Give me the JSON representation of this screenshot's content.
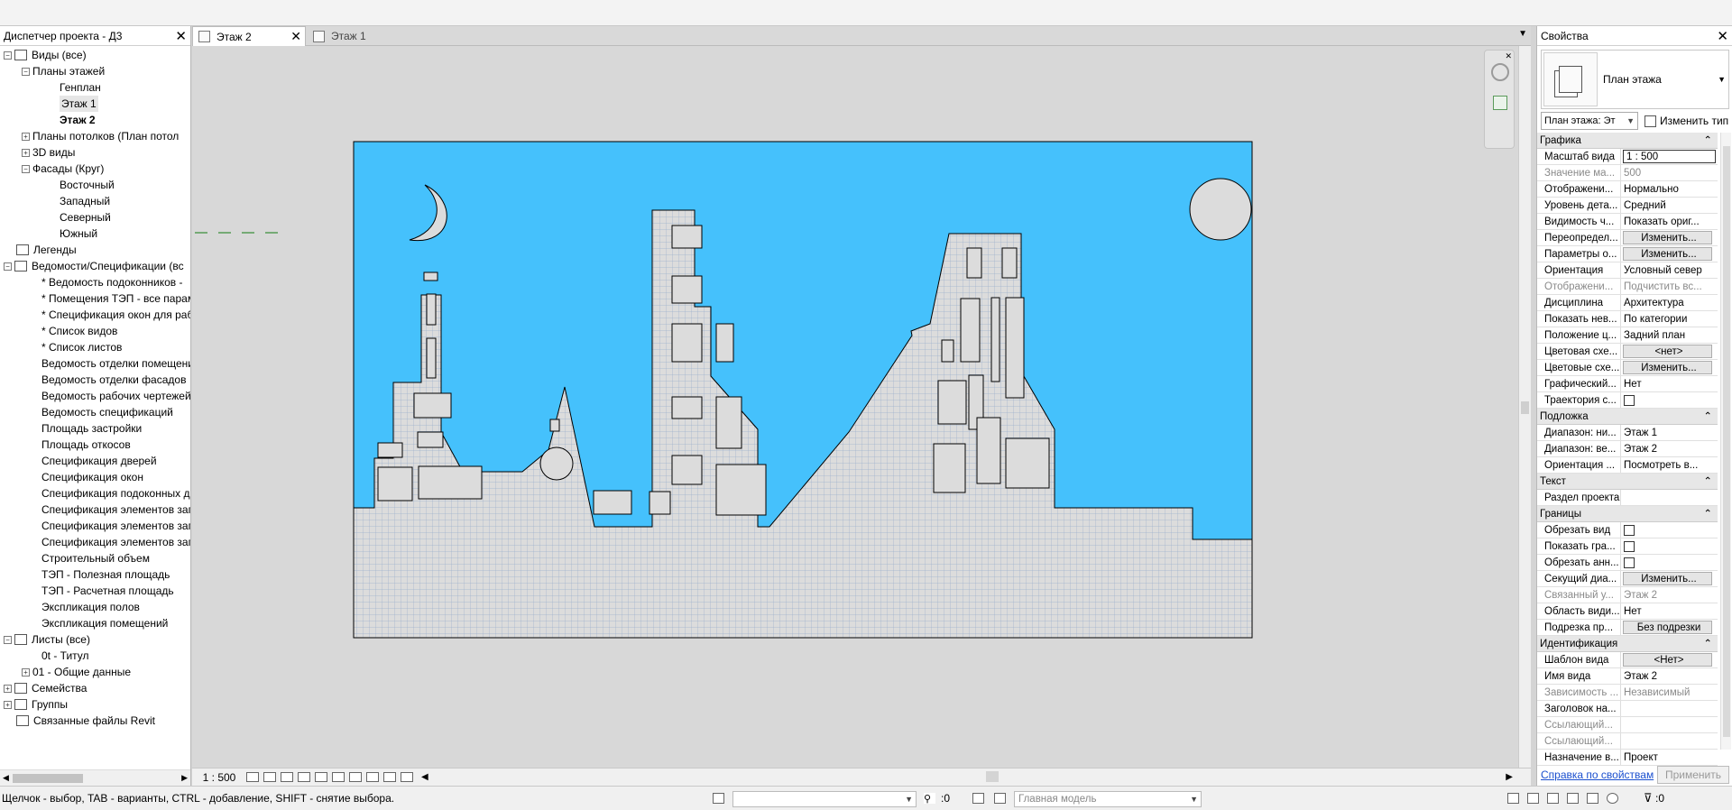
{
  "project_browser": {
    "title": "Диспетчер проекта - Д3",
    "items": [
      {
        "label": "Виды (все)",
        "level": 0,
        "toggle": "−"
      },
      {
        "label": "Планы этажей",
        "level": 1,
        "toggle": "−"
      },
      {
        "label": "Генплан",
        "level": 2
      },
      {
        "label": "Этаж 1",
        "level": 2
      },
      {
        "label": "Этаж 2",
        "level": 2,
        "bold": true
      },
      {
        "label": "Планы потолков (План потол",
        "level": 1,
        "toggle": "+"
      },
      {
        "label": "3D виды",
        "level": 1,
        "toggle": "+"
      },
      {
        "label": "Фасады (Круг)",
        "level": 1,
        "toggle": "−"
      },
      {
        "label": "Восточный",
        "level": 2
      },
      {
        "label": "Западный",
        "level": 2
      },
      {
        "label": "Северный",
        "level": 2
      },
      {
        "label": "Южный",
        "level": 2
      },
      {
        "label": "Легенды",
        "level": 0,
        "icon": true
      },
      {
        "label": "Ведомости/Спецификации (вс",
        "level": 0,
        "toggle": "−",
        "icon": true
      },
      {
        "label": "* Ведомость подоконников -",
        "level": 1
      },
      {
        "label": "* Помещения ТЭП - все парам",
        "level": 1
      },
      {
        "label": "* Спецификация окон для раб",
        "level": 1
      },
      {
        "label": "* Список видов",
        "level": 1
      },
      {
        "label": "* Список листов",
        "level": 1
      },
      {
        "label": "Ведомость отделки помещени",
        "level": 1
      },
      {
        "label": "Ведомость отделки фасадов",
        "level": 1
      },
      {
        "label": "Ведомость рабочих чертежей",
        "level": 1
      },
      {
        "label": "Ведомость спецификаций",
        "level": 1
      },
      {
        "label": "Площадь застройки",
        "level": 1
      },
      {
        "label": "Площадь откосов",
        "level": 1
      },
      {
        "label": "Спецификация дверей",
        "level": 1
      },
      {
        "label": "Спецификация окон",
        "level": 1
      },
      {
        "label": "Спецификация подоконных д",
        "level": 1
      },
      {
        "label": "Спецификация элементов зап",
        "level": 1
      },
      {
        "label": "Спецификация элементов зап",
        "level": 1
      },
      {
        "label": "Спецификация элементов зап",
        "level": 1
      },
      {
        "label": "Строительный объем",
        "level": 1
      },
      {
        "label": "ТЭП - Полезная площадь",
        "level": 1
      },
      {
        "label": "ТЭП - Расчетная площадь",
        "level": 1
      },
      {
        "label": "Экспликация полов",
        "level": 1
      },
      {
        "label": "Экспликация помещений",
        "level": 1
      },
      {
        "label": "Листы (все)",
        "level": 0,
        "toggle": "−",
        "icon": true
      },
      {
        "label": "0t - Титул",
        "level": 1
      },
      {
        "label": "01 - Общие данные",
        "level": 1,
        "toggle": "+"
      },
      {
        "label": "Семейства",
        "level": 0,
        "toggle": "+",
        "icon": true
      },
      {
        "label": "Группы",
        "level": 0,
        "toggle": "+",
        "icon": true
      },
      {
        "label": "Связанные файлы Revit",
        "level": 0,
        "icon": true
      }
    ]
  },
  "tabs": [
    {
      "label": "Этаж 2",
      "active": true
    },
    {
      "label": "Этаж 1",
      "active": false
    }
  ],
  "view_control": {
    "scale": "1 : 500"
  },
  "properties": {
    "title": "Свойства",
    "type_name": "План этажа",
    "filter": "План этажа: Эт",
    "edit_type": "Изменить тип",
    "groups": [
      {
        "name": "Графика",
        "rows": [
          {
            "name": "Масштаб вида",
            "value": "1 : 500",
            "kind": "edit"
          },
          {
            "name": "Значение ма...",
            "value": "500",
            "kind": "gray"
          },
          {
            "name": "Отображени...",
            "value": "Нормально"
          },
          {
            "name": "Уровень дета...",
            "value": "Средний"
          },
          {
            "name": "Видимость ч...",
            "value": "Показать ориг..."
          },
          {
            "name": "Переопредел...",
            "value": "Изменить...",
            "kind": "btn"
          },
          {
            "name": "Параметры о...",
            "value": "Изменить...",
            "kind": "btn"
          },
          {
            "name": "Ориентация",
            "value": "Условный север"
          },
          {
            "name": "Отображени...",
            "value": "Подчистить вс...",
            "kind": "gray"
          },
          {
            "name": "Дисциплина",
            "value": "Архитектура"
          },
          {
            "name": "Показать нев...",
            "value": "По категории"
          },
          {
            "name": "Положение ц...",
            "value": "Задний план"
          },
          {
            "name": "Цветовая схе...",
            "value": "<нет>",
            "kind": "btn"
          },
          {
            "name": "Цветовые схе...",
            "value": "Изменить...",
            "kind": "btn"
          },
          {
            "name": "Графический...",
            "value": "Нет"
          },
          {
            "name": "Траектория с...",
            "value": "",
            "kind": "check"
          }
        ]
      },
      {
        "name": "Подложка",
        "rows": [
          {
            "name": "Диапазон: ни...",
            "value": "Этаж 1"
          },
          {
            "name": "Диапазон: ве...",
            "value": "Этаж 2"
          },
          {
            "name": "Ориентация ...",
            "value": "Посмотреть в..."
          }
        ]
      },
      {
        "name": "Текст",
        "rows": [
          {
            "name": "Раздел проекта",
            "value": ""
          }
        ]
      },
      {
        "name": "Границы",
        "rows": [
          {
            "name": "Обрезать вид",
            "value": "",
            "kind": "check"
          },
          {
            "name": "Показать гра...",
            "value": "",
            "kind": "check"
          },
          {
            "name": "Обрезать анн...",
            "value": "",
            "kind": "check"
          },
          {
            "name": "Секущий диа...",
            "value": "Изменить...",
            "kind": "btn"
          },
          {
            "name": "Связанный у...",
            "value": "Этаж 2",
            "kind": "gray"
          },
          {
            "name": "Область види...",
            "value": "Нет"
          },
          {
            "name": "Подрезка пр...",
            "value": "Без подрезки",
            "kind": "btn"
          }
        ]
      },
      {
        "name": "Идентификация",
        "rows": [
          {
            "name": "Шаблон вида",
            "value": "<Нет>",
            "kind": "btn"
          },
          {
            "name": "Имя вида",
            "value": "Этаж 2"
          },
          {
            "name": "Зависимость ...",
            "value": "Независимый",
            "kind": "gray"
          },
          {
            "name": "Заголовок на...",
            "value": ""
          },
          {
            "name": "Ссылающий...",
            "value": "",
            "kind": "gray"
          },
          {
            "name": "Ссылающий...",
            "value": "",
            "kind": "gray"
          },
          {
            "name": "Назначение в...",
            "value": "Проект"
          }
        ]
      }
    ],
    "help_link": "Справка по свойствам",
    "apply": "Применить"
  },
  "status_bar": {
    "hint": "Щелчок - выбор, TAB - варианты, CTRL - добавление, SHIFT - снятие выбора.",
    "selection_count": ":0",
    "model": "Главная модель",
    "filter_count": ":0"
  },
  "colors": {
    "sky": "#45c1fc",
    "building_fill": "#dcdcdc",
    "grid": "#9db0cc"
  }
}
